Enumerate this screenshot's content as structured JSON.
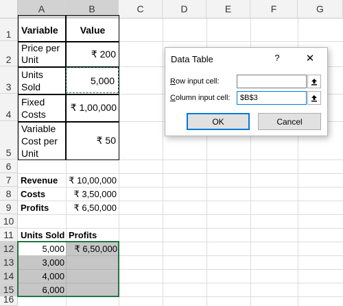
{
  "columns": [
    "A",
    "B",
    "C",
    "D",
    "E",
    "F",
    "G"
  ],
  "rows": [
    "1",
    "2",
    "3",
    "4",
    "5",
    "6",
    "7",
    "8",
    "9",
    "10",
    "11",
    "12",
    "13",
    "14",
    "15",
    "16"
  ],
  "input_table": {
    "header_variable": "Variable",
    "header_value": "Value",
    "price_label": "Price per Unit",
    "price_value": "₹ 200",
    "units_label": "Units Sold",
    "units_value": "5,000",
    "fixed_label": "Fixed Costs",
    "fixed_value": "₹ 1,00,000",
    "varcost_label": "Variable Cost per Unit",
    "varcost_value": "₹ 50"
  },
  "summary": {
    "revenue_label": "Revenue",
    "revenue_value": "₹ 10,00,000",
    "costs_label": "Costs",
    "costs_value": "₹ 3,50,000",
    "profits_label": "Profits",
    "profits_value": "₹ 6,50,000"
  },
  "data_table": {
    "header_units": "Units Sold",
    "header_profits": "Profits",
    "rows": [
      {
        "units": "5,000",
        "profit": "₹ 6,50,000"
      },
      {
        "units": "3,000",
        "profit": ""
      },
      {
        "units": "4,000",
        "profit": ""
      },
      {
        "units": "6,000",
        "profit": ""
      }
    ]
  },
  "dialog": {
    "title": "Data Table",
    "help": "?",
    "close": "✕",
    "row_label": "Row input cell:",
    "row_value": "",
    "column_label": "Column input cell:",
    "column_value": "$B$3",
    "ok": "OK",
    "cancel": "Cancel",
    "picker_icon": "collapse-dialog-icon"
  },
  "colors": {
    "selection_border": "#217346",
    "range_fill": "#c6c6c6",
    "ok_border": "#0078d7"
  }
}
